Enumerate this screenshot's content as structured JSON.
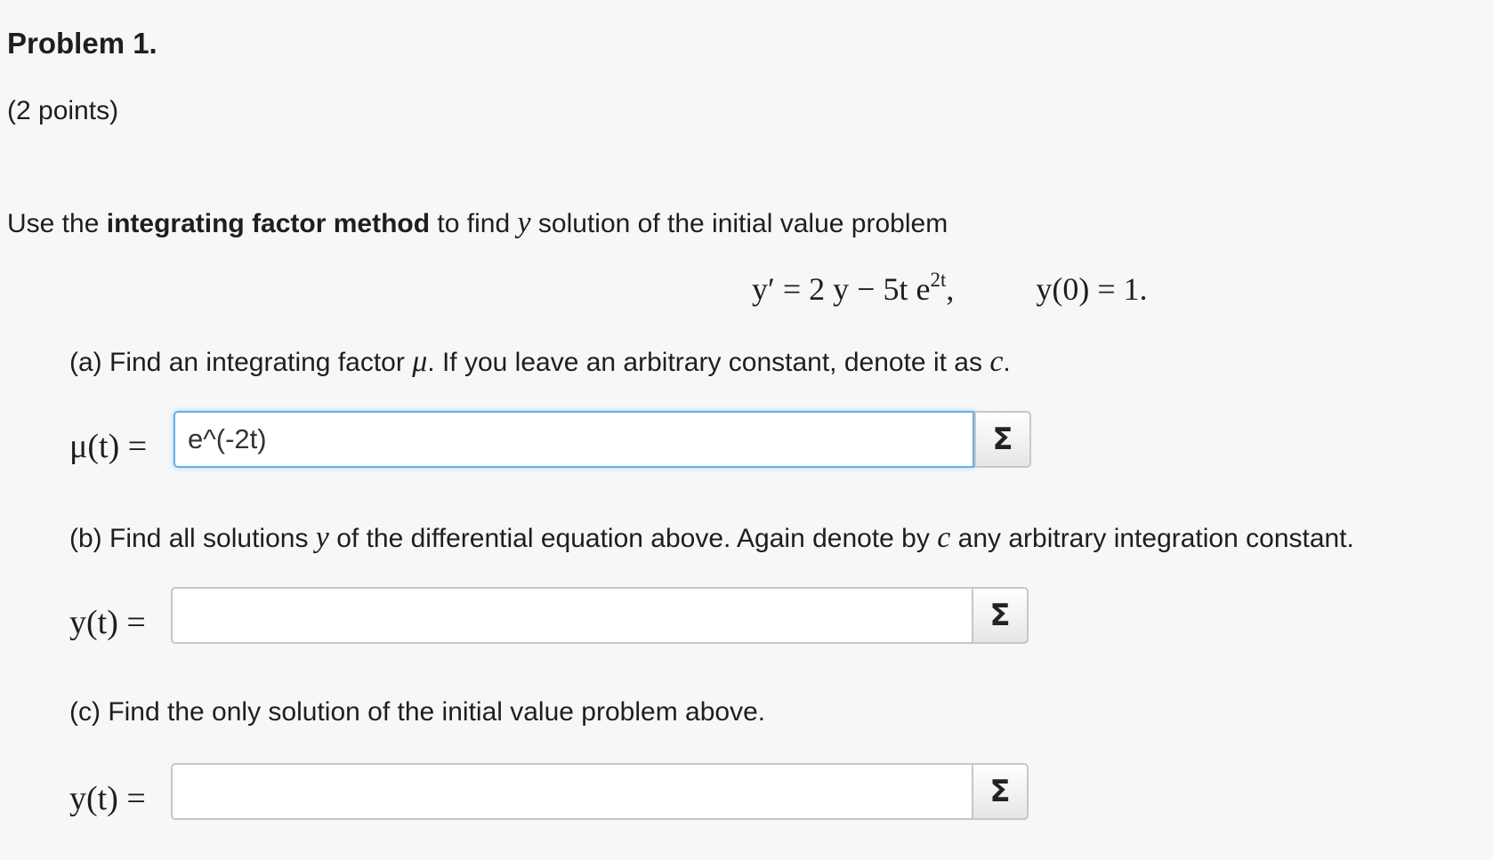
{
  "problem": {
    "title": "Problem 1.",
    "points": "(2 points)"
  },
  "intro": {
    "prefix": "Use the ",
    "emphasis": "integrating factor method",
    "middle": " to find ",
    "var": "y",
    "suffix": " solution of the initial value problem"
  },
  "equation": {
    "lhs": "y′ = 2 y − 5t e",
    "exponent": "2t",
    "sep": ",",
    "initial_condition": "y(0) = 1."
  },
  "part_a": {
    "text_before": "(a) Find an integrating factor ",
    "var": "μ",
    "text_after": ". If you leave an arbitrary constant, denote it as ",
    "const": "c",
    "end": ".",
    "label": "μ(t) =",
    "value": "e^(-2t)",
    "placeholder": ""
  },
  "part_b": {
    "text_before": "(b) Find all solutions ",
    "var": "y",
    "text_middle": " of the differential equation above. Again denote by ",
    "const": "c",
    "text_after": " any arbitrary integration constant.",
    "label": "y(t) =",
    "value": "",
    "placeholder": ""
  },
  "part_c": {
    "text": "(c) Find the only solution of the initial value problem above.",
    "label": "y(t) =",
    "value": "",
    "placeholder": ""
  },
  "equation_editor_button": {
    "label": "Σ",
    "icon": "sigma-icon"
  },
  "colors": {
    "focus_border": "#66afe9",
    "background": "#f7f7f7"
  }
}
